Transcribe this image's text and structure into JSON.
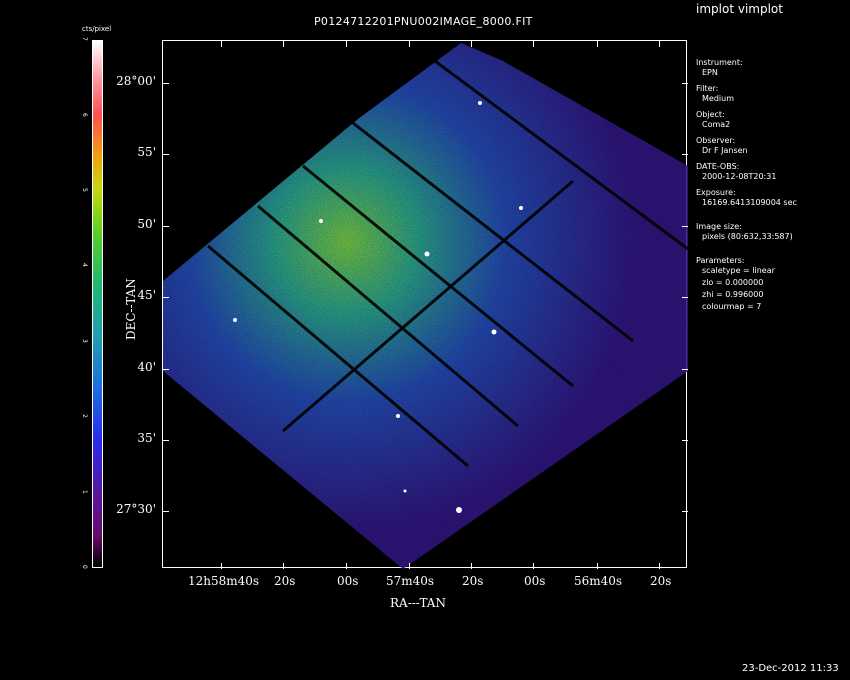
{
  "window": {
    "title": "implot vimplot"
  },
  "plot": {
    "title": "P0124712201PNU002IMAGE_8000.FIT",
    "xlabel": "RA---TAN",
    "ylabel": "DEC--TAN",
    "x_ticks": [
      "12h58m40s",
      "20s",
      "00s",
      "57m40s",
      "20s",
      "00s",
      "56m40s",
      "20s"
    ],
    "y_ticks": [
      "28°00'",
      "55'",
      "50'",
      "45'",
      "40'",
      "35'",
      "27°30'"
    ]
  },
  "colorbar": {
    "unit": "cts/pixel",
    "ticks": [
      "0",
      "1",
      "2",
      "3",
      "4",
      "5",
      "6",
      "7"
    ]
  },
  "info": {
    "instrument_label": "Instrument:",
    "instrument": "EPN",
    "filter_label": "Filter:",
    "filter": "Medium",
    "object_label": "Object:",
    "object": "Coma2",
    "observer_label": "Observer:",
    "observer": "Dr F Jansen",
    "date_label": "DATE-OBS:",
    "date": "2000-12-08T20:31",
    "exposure_label": "Exposure:",
    "exposure": "16169.6413109004 sec",
    "imgsize_label": "Image size:",
    "imgsize": "pixels (80:632,33:587)",
    "params_label": "Parameters:",
    "scaletype": "scaletype = linear",
    "zlo": "zlo = 0.000000",
    "zhi": "zhi = 0.996000",
    "colourmap": "colourmap =   7"
  },
  "footer": {
    "timestamp": "23-Dec-2012 11:33"
  },
  "colors": {
    "background": "#000000",
    "foreground": "#ffffff"
  }
}
